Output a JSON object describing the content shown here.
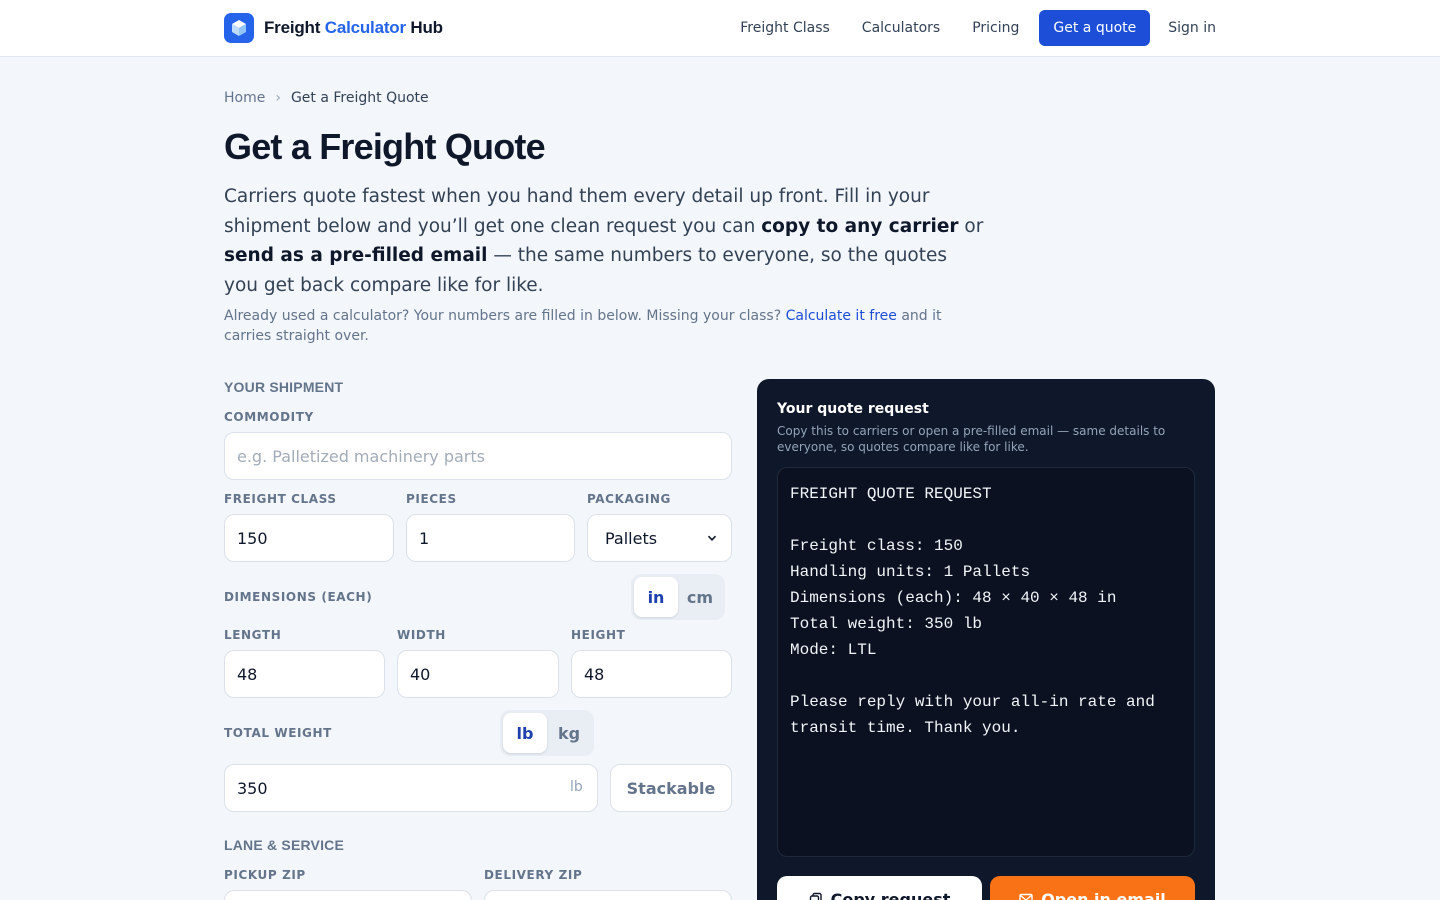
{
  "header": {
    "brand": {
      "part1": "Freight",
      "part2": "Calculator",
      "part3": "Hub"
    },
    "nav": [
      {
        "label": "Freight Class"
      },
      {
        "label": "Calculators"
      },
      {
        "label": "Pricing"
      }
    ],
    "cta_label": "Get a quote",
    "signin_label": "Sign in"
  },
  "breadcrumb": {
    "home": "Home",
    "separator": "›",
    "current": "Get a Freight Quote"
  },
  "page": {
    "title": "Get a Freight Quote",
    "lead": {
      "p1": "Carriers quote fastest when you hand them every detail up front. Fill in your shipment below and you’ll get one clean request you can ",
      "b1": "copy to any carrier",
      "p2": " or ",
      "b2": "send as a pre-filled email",
      "p3": " — the same numbers to everyone, so the quotes you get back compare like for like."
    },
    "sub": {
      "p1": "Already used a calculator? Your numbers are filled in below. Missing your class? ",
      "link": "Calculate it free",
      "p2": " and it carries straight over."
    }
  },
  "form": {
    "section_shipment": "YOUR SHIPMENT",
    "commodity": {
      "label": "COMMODITY",
      "placeholder": "e.g. Palletized machinery parts",
      "value": ""
    },
    "freight_class": {
      "label": "FREIGHT CLASS",
      "value": "150"
    },
    "pieces": {
      "label": "PIECES",
      "value": "1"
    },
    "packaging": {
      "label": "PACKAGING",
      "value": "Pallets"
    },
    "dimensions": {
      "label": "DIMENSIONS (EACH)",
      "units": [
        "in",
        "cm"
      ],
      "selected_unit": "in",
      "length": {
        "label": "LENGTH",
        "value": "48"
      },
      "width": {
        "label": "WIDTH",
        "value": "40"
      },
      "height": {
        "label": "HEIGHT",
        "value": "48"
      }
    },
    "weight": {
      "label": "TOTAL WEIGHT",
      "units": [
        "lb",
        "kg"
      ],
      "selected_unit": "lb",
      "value": "350",
      "suffix": "lb"
    },
    "stackable_label": "Stackable",
    "section_lane": "LANE & SERVICE",
    "pickup_zip": {
      "label": "PICKUP ZIP"
    },
    "delivery_zip": {
      "label": "DELIVERY ZIP"
    }
  },
  "quote": {
    "title": "Your quote request",
    "subtitle": "Copy this to carriers or open a pre-filled email — same details to everyone, so quotes compare like for like.",
    "text": "FREIGHT QUOTE REQUEST\n\nFreight class: 150\nHandling units: 1 Pallets\nDimensions (each): 48 × 40 × 48 in\nTotal weight: 350 lb\nMode: LTL\n\nPlease reply with your all-in rate and\ntransit time. Thank you.",
    "copy_label": "Copy request",
    "email_label": "Open in email"
  },
  "colors": {
    "brand": "#2563eb",
    "cta": "#1d4ed8",
    "panel": "#0f172a",
    "email_button": "#f97316"
  },
  "icons": [
    "logo-cube-icon",
    "chevron-right-icon",
    "chevron-down-icon",
    "copy-icon",
    "mail-icon"
  ]
}
